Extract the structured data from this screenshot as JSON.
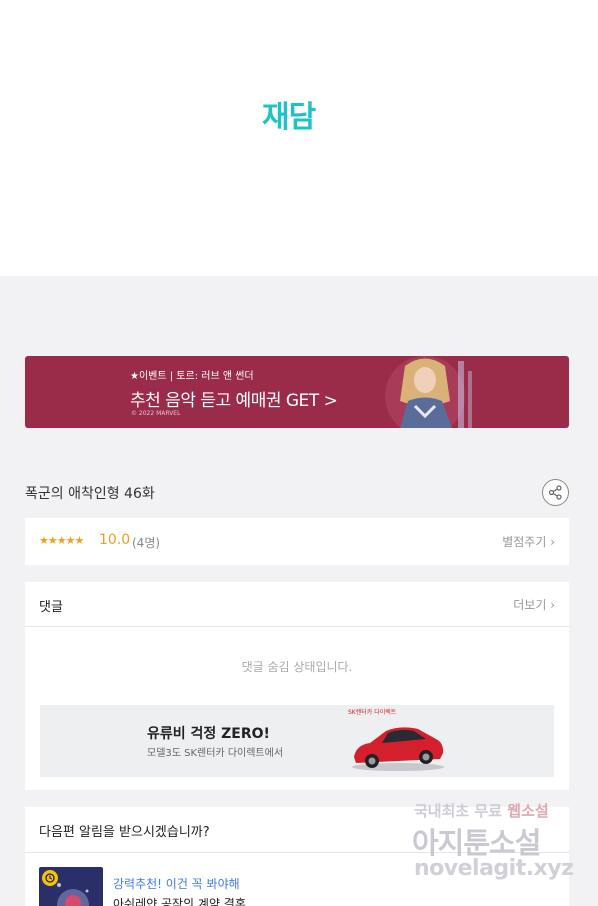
{
  "app": {
    "logo": "재담"
  },
  "banner": {
    "small": "★이벤트 | 토르: 러브 앤 썬더",
    "big": "추천 음악 듣고 예매권 GET >",
    "copyright": "© 2022 MARVEL"
  },
  "episode": {
    "title": "폭군의 애착인형 46화"
  },
  "rating": {
    "stars": "★★★★★",
    "score": "10.0",
    "count": "(4명)",
    "rate_link": "별점주기 ›"
  },
  "comments": {
    "header": "댓글",
    "more": "더보기 ›",
    "hidden_message": "댓글 숨김 상태입니다."
  },
  "ad": {
    "title": "유류비 걱정 ZERO!",
    "subtitle": "모델3도 SK렌터카 다이렉트에서",
    "brand": "SK렌터카 다이렉트"
  },
  "notify": {
    "question": "다음편 알림을 받으시겠습니까?",
    "rec_label": "강력추천! 이건 꼭 봐야해",
    "rec_title": "아쉬레얀 공작의 계약 결혼"
  },
  "watermark": {
    "line1": "국내최초 무료",
    "line1_accent": "웹소설",
    "line2": "아지툰소설",
    "line3": "novelagit.xyz"
  },
  "colors": {
    "accent": "#1cc4c9",
    "banner_bg": "#9a2c49",
    "star": "#f0a01e",
    "link_blue": "#3d7bf0"
  }
}
